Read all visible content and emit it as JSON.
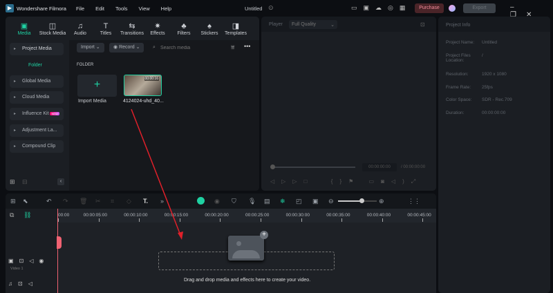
{
  "app": {
    "title": "Wondershare Filmora",
    "project": "Untitled",
    "menu": [
      "File",
      "Edit",
      "Tools",
      "View",
      "Help"
    ],
    "purchase": "Purchase",
    "export": "Export",
    "accent": "#1fd1a2"
  },
  "tabs": [
    {
      "label": "Media",
      "icon": "media-icon"
    },
    {
      "label": "Stock Media",
      "icon": "stock-media-icon"
    },
    {
      "label": "Audio",
      "icon": "audio-icon"
    },
    {
      "label": "Titles",
      "icon": "titles-icon"
    },
    {
      "label": "Transitions",
      "icon": "transitions-icon"
    },
    {
      "label": "Effects",
      "icon": "effects-icon"
    },
    {
      "label": "Filters",
      "icon": "filters-icon"
    },
    {
      "label": "Stickers",
      "icon": "stickers-icon"
    },
    {
      "label": "Templates",
      "icon": "templates-icon"
    }
  ],
  "sidebar": {
    "project_media": "Project Media",
    "folder": "Folder",
    "items": [
      "Global Media",
      "Cloud Media",
      "Influence Kit",
      "Adjustment La...",
      "Compound Clip"
    ],
    "new_badge": "NEW"
  },
  "media": {
    "import": "Import",
    "record": "Record",
    "search_placeholder": "Search media",
    "section": "FOLDER",
    "import_media": "Import Media",
    "clip_name": "4124024-uhd_40...",
    "clip_duration": "00:00:16"
  },
  "player": {
    "label": "Player",
    "quality": "Full Quality",
    "current_time": "00:00:00:00",
    "total_time": "/ 00:00:00:00"
  },
  "project_info": {
    "title": "Project Info",
    "rows": [
      {
        "k": "Project Name:",
        "v": "Untitled"
      },
      {
        "k": "Project Files Location:",
        "v": "/"
      },
      {
        "k": "Resolution:",
        "v": "1920 x 1080"
      },
      {
        "k": "Frame Rate:",
        "v": "25fps"
      },
      {
        "k": "Color Space:",
        "v": "SDR - Rec.709"
      },
      {
        "k": "Duration:",
        "v": "00:00:00:00"
      }
    ]
  },
  "timeline": {
    "ticks": [
      "00:00",
      "00:00:05:00",
      "00:00:10:00",
      "00:00:15:00",
      "00:00:20:00",
      "00:00:25:00",
      "00:00:30:00",
      "00:00:35:00",
      "00:00:40:00",
      "00:00:45:00"
    ],
    "video_track": "Video 1",
    "drop_hint": "Drag and drop media and effects here to create your video.",
    "zoom_level": 0.6
  }
}
